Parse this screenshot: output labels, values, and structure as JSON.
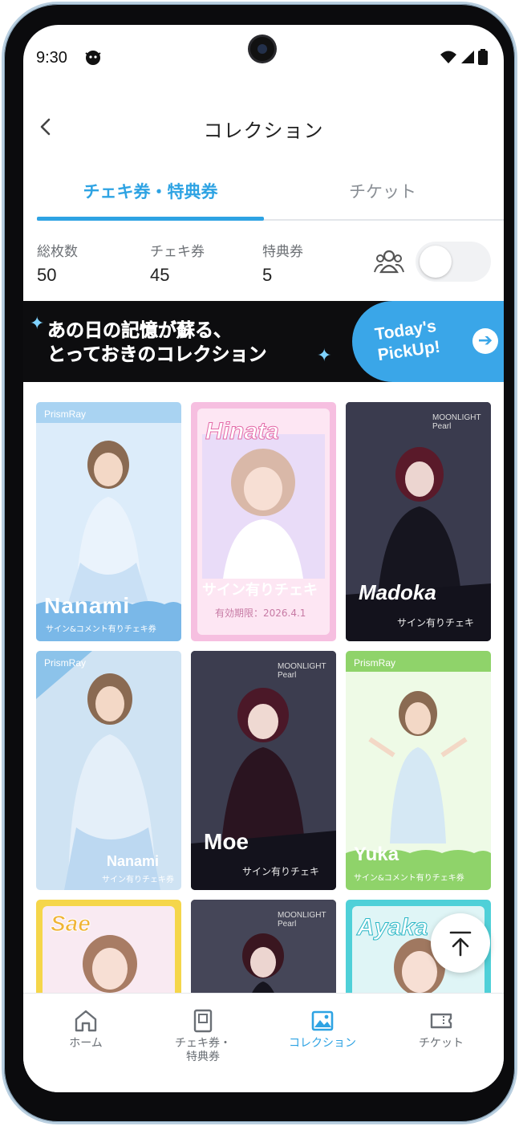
{
  "status_bar": {
    "time": "9:30"
  },
  "header": {
    "title": "コレクション"
  },
  "tabs": [
    {
      "label": "チェキ券・特典券",
      "active": true
    },
    {
      "label": "チケット",
      "active": false
    }
  ],
  "stats": [
    {
      "label": "総枚数",
      "value": "50"
    },
    {
      "label": "チェキ券",
      "value": "45"
    },
    {
      "label": "特典券",
      "value": "5"
    }
  ],
  "banner": {
    "line1": "あの日の記憶が蘇る、",
    "line2": "とっておきのコレクション",
    "pick_line1": "Today's",
    "pick_line2": "PickUp!"
  },
  "cards": [
    {
      "brand": "PrismRay",
      "name": "Nanami",
      "sub": "サイン&コメント有りチェキ券",
      "bg": "#a9d3f2"
    },
    {
      "brand": "",
      "name": "Hinata",
      "sub": "サイン有りチェキ",
      "extra": "有効期限：2026.4.1",
      "bg": "#f6bfe0"
    },
    {
      "brand": "MOONLIGHT Pearl",
      "name": "Madoka",
      "sub": "サイン有りチェキ",
      "bg": "#1c1b2a"
    },
    {
      "brand": "PrismRay",
      "name": "Nanami",
      "sub": "サイン有りチェキ券",
      "bg": "#cfe3f3"
    },
    {
      "brand": "MOONLIGHT Pearl",
      "name": "Moe",
      "sub": "サイン有りチェキ",
      "bg": "#1e1c2b"
    },
    {
      "brand": "PrismRay",
      "name": "Yuka",
      "sub": "サイン&コメント有りチェキ券",
      "bg": "#dff3d4"
    },
    {
      "brand": "",
      "name": "Sae",
      "sub": "",
      "bg": "#f5d64a"
    },
    {
      "brand": "MOONLIGHT Pearl",
      "name": "",
      "sub": "",
      "bg": "#2a2838"
    },
    {
      "brand": "",
      "name": "Ayaka",
      "sub": "",
      "bg": "#4fd0d8"
    }
  ],
  "bottom_nav": [
    {
      "label": "ホーム",
      "active": false
    },
    {
      "label": "チェキ券・\n特典券",
      "active": false
    },
    {
      "label": "コレクション",
      "active": true
    },
    {
      "label": "チケット",
      "active": false
    }
  ],
  "colors": {
    "accent": "#2ea3e3",
    "banner_bg": "#0d0d0f",
    "pickup_bg": "#3aa6e8"
  }
}
